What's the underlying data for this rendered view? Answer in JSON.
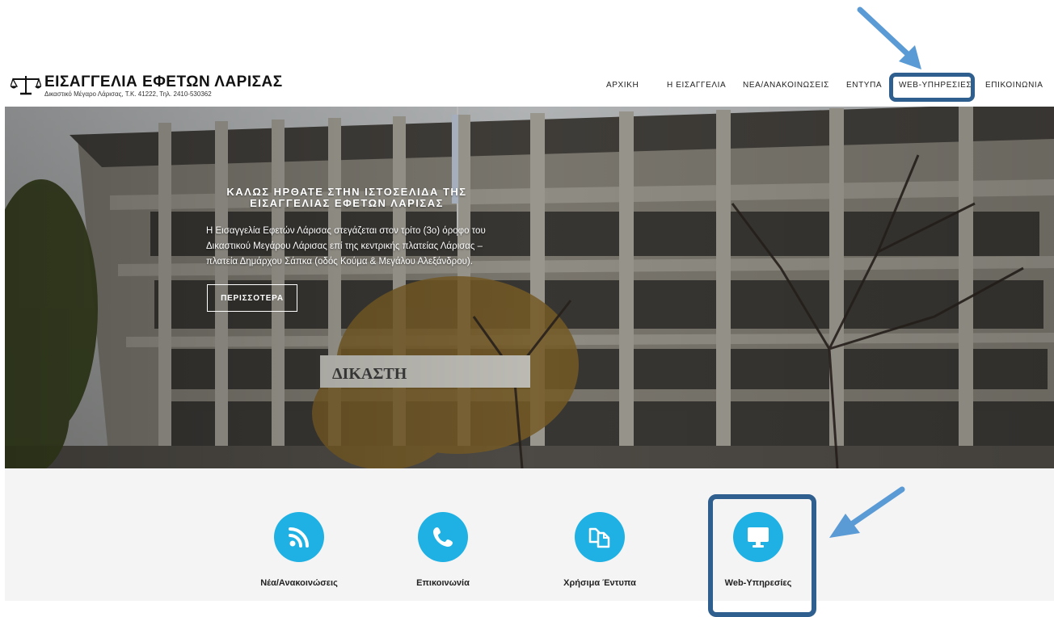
{
  "header": {
    "logo_title": "ΕΙΣΑΓΓΕΛΙΑ ΕΦΕΤΩΝ ΛΑΡΙΣΑΣ",
    "logo_subtitle": "Δικαστικό Μέγαρο Λάρισας, Τ.Κ. 41222, Τηλ. 2410-530362",
    "nav": [
      {
        "label": "ΑΡΧΙΚΗ"
      },
      {
        "label": "Η ΕΙΣΑΓΓΕΛΙΑ"
      },
      {
        "label": "ΝΕΑ/ΑΝΑΚΟΙΝΩΣΕΙΣ"
      },
      {
        "label": "ΕΝΤΥΠΑ"
      },
      {
        "label": "WEB-ΥΠΗΡΕΣΙΕΣ"
      },
      {
        "label": "ΕΠΙΚΟΙΝΩΝΙΑ"
      }
    ]
  },
  "hero": {
    "heading_line1": "ΚΑΛΩΣ ΗΡΘΑΤΕ ΣΤΗΝ ΙΣΤΟΣΕΛΙΔΑ ΤΗΣ",
    "heading_line2": "ΕΙΣΑΓΓΕΛΙΑΣ ΕΦΕΤΩΝ ΛΑΡΙΣΑΣ",
    "text_line1": "Η Εισαγγελία Εφετών Λάρισας στεγάζεται στον τρίτο (3ο) όροφο του",
    "text_line2": "Δικαστικού Μεγάρου Λάρισας επί της κεντρικής πλατείας Λάρισας –",
    "text_line3": "πλατεία Δημάρχου Σάπκα (οδός Κούμα & Μεγάλου Αλεξάνδρου).",
    "button_label": "ΠΕΡΙΣΣΟΤΕΡΑ",
    "building_sign": "ΔΙΚΑΣΤΗ"
  },
  "services": [
    {
      "label": "Νέα/Ανακοινώσεις",
      "icon": "rss-icon"
    },
    {
      "label": "Επικοινωνία",
      "icon": "phone-icon"
    },
    {
      "label": "Χρήσιμα Έντυπα",
      "icon": "documents-icon"
    },
    {
      "label": "Web-Υπηρεσίες",
      "icon": "monitor-icon"
    }
  ],
  "colors": {
    "accent": "#1fb1e3",
    "highlight_box": "#2f5f8f",
    "arrow": "#5b9bd5"
  }
}
